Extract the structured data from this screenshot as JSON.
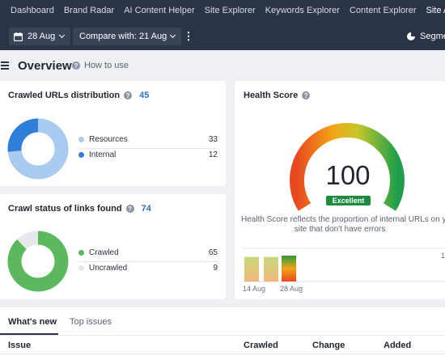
{
  "nav": {
    "items": [
      "Dashboard",
      "Brand Radar",
      "AI Content Helper",
      "Site Explorer",
      "Keywords Explorer",
      "Content Explorer",
      "Site Audit"
    ],
    "active_index": 6
  },
  "toolbar": {
    "date_label": "28 Aug",
    "compare_label": "Compare with: 21 Aug",
    "more_label": "⋮",
    "segment_label": "Segme"
  },
  "overview": {
    "title": "Overview",
    "how_to": "How to use"
  },
  "crawled_urls": {
    "title": "Crawled URLs distribution",
    "count": "45",
    "legend": [
      {
        "label": "Resources",
        "value": "33",
        "color": "#a9cbef"
      },
      {
        "label": "Internal",
        "value": "12",
        "color": "#2f7ed8"
      }
    ],
    "values": [
      33,
      12
    ]
  },
  "crawl_status": {
    "title": "Crawl status of links found",
    "count": "74",
    "legend": [
      {
        "label": "Crawled",
        "value": "65",
        "color": "#5cb85c"
      },
      {
        "label": "Uncrawled",
        "value": "9",
        "color": "#e6e8ec"
      }
    ],
    "values": [
      65,
      9
    ]
  },
  "health": {
    "title": "Health Score",
    "score": "100",
    "badge": "Excellent",
    "desc_line1": "Health Score reflects the proportion of internal URLs on you",
    "desc_line2": "site that don't have errors",
    "x_labels": [
      "14 Aug",
      "28 Aug"
    ],
    "right_tick": "1",
    "bars": [
      0.74,
      0.74,
      0.78
    ]
  },
  "tabs": {
    "items": [
      "What's new",
      "Top issues"
    ],
    "active_index": 0
  },
  "table": {
    "headers": [
      "Issue",
      "Crawled",
      "Change",
      "Added"
    ]
  }
}
